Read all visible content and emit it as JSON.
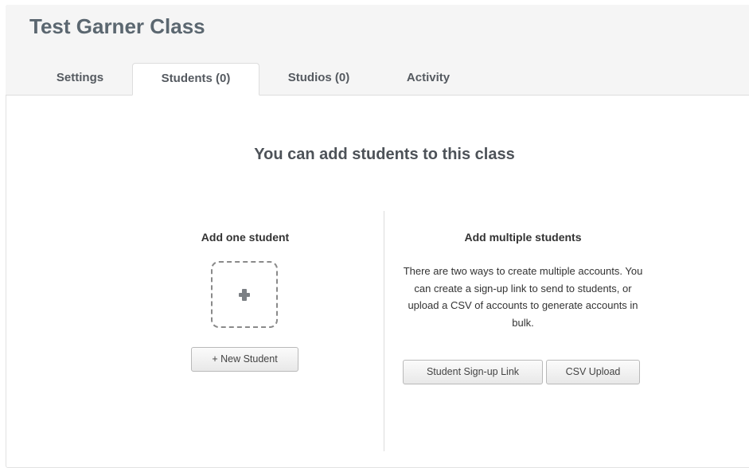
{
  "class": {
    "title": "Test Garner Class"
  },
  "tabs": [
    {
      "label": "Settings",
      "active": false
    },
    {
      "label": "Students (0)",
      "active": true
    },
    {
      "label": "Studios (0)",
      "active": false
    },
    {
      "label": "Activity",
      "active": false
    }
  ],
  "main": {
    "heading": "You can add students to this class",
    "add_one": {
      "title": "Add one student",
      "icon": "plus-icon",
      "button_label": "+ New Student"
    },
    "add_multiple": {
      "title": "Add multiple students",
      "description": "There are two ways to create multiple accounts. You can create a sign-up link to send to students, or upload a CSV of accounts to generate accounts in bulk.",
      "signup_button_label": "Student Sign-up Link",
      "csv_button_label": "CSV Upload"
    }
  }
}
